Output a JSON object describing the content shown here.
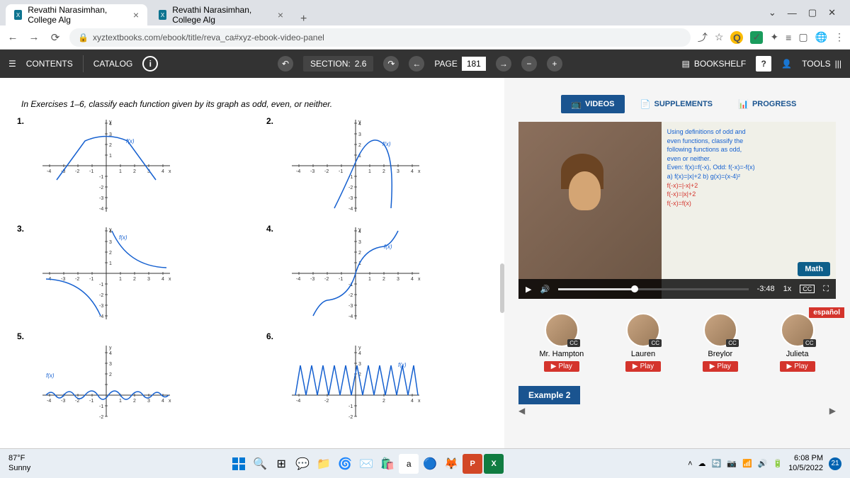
{
  "browser": {
    "tabs": [
      {
        "title": "Revathi Narasimhan, College Alg"
      },
      {
        "title": "Revathi Narasimhan, College Alg"
      }
    ],
    "url": "xyztextbooks.com/ebook/title/reva_ca#xyz-ebook-video-panel"
  },
  "toolbar": {
    "contents": "CONTENTS",
    "catalog": "CATALOG",
    "section_label": "SECTION:",
    "section_value": "2.6",
    "page_label": "PAGE",
    "page_value": "181",
    "bookshelf": "BOOKSHELF",
    "tools": "TOOLS"
  },
  "exercises": {
    "header": "In Exercises 1–6, classify each function given by its graph as odd, even, or neither.",
    "items": [
      "1.",
      "2.",
      "3.",
      "4.",
      "5.",
      "6."
    ],
    "fx_label": "f(x)",
    "y_label": "y",
    "x_label": "x"
  },
  "video_panel": {
    "tabs": {
      "videos": "VIDEOS",
      "supplements": "SUPPLEMENTS",
      "progress": "PROGRESS"
    },
    "whiteboard_lines": [
      "Using definitions of odd and",
      "even functions, classify the",
      "following functions as odd,",
      "even or neither.",
      "Even: f(x)=f(-x), Odd: f(-x)=-f(x)",
      "a) f(x)=|x|+2   b) g(x)=(x-4)²",
      "f(-x)=|-x|+2",
      "f(-x)=|x|+2",
      "f(-x)=f(x)"
    ],
    "logo": "Math",
    "time": "-3:48",
    "speed": "1x",
    "cc": "CC",
    "instructors": [
      {
        "name": "Mr. Hampton"
      },
      {
        "name": "Lauren"
      },
      {
        "name": "Breylor"
      },
      {
        "name": "Julieta"
      }
    ],
    "play_label": "Play",
    "cc_badge": "CC",
    "espanol": "español",
    "example": "Example 2"
  },
  "taskbar": {
    "temp": "87°F",
    "condition": "Sunny",
    "time": "6:08 PM",
    "date": "10/5/2022",
    "notifications": "21"
  },
  "chart_data": [
    {
      "id": 1,
      "type": "graph",
      "description": "Even tent/triangle function peaking at y≈3 at x=0, symmetric",
      "xrange": [
        -4,
        4
      ],
      "yrange": [
        -4,
        4
      ]
    },
    {
      "id": 2,
      "type": "graph",
      "description": "Cubic-like curve rising through origin then dipping",
      "xrange": [
        -4,
        4
      ],
      "yrange": [
        -4,
        4
      ]
    },
    {
      "id": 3,
      "type": "graph",
      "description": "Odd reciprocal-like curve with vertical asymptote at x=0",
      "xrange": [
        -4,
        4
      ],
      "yrange": [
        -4,
        4
      ]
    },
    {
      "id": 4,
      "type": "graph",
      "description": "S-curve / arctangent-like, odd symmetry",
      "xrange": [
        -4,
        4
      ],
      "yrange": [
        -4,
        4
      ]
    },
    {
      "id": 5,
      "type": "graph",
      "description": "Damped oscillation / sine wave variant",
      "xrange": [
        -4,
        4
      ],
      "yrange": [
        -2,
        4
      ]
    },
    {
      "id": 6,
      "type": "graph",
      "description": "High-frequency absolute sine wave, even",
      "xrange": [
        -4,
        4
      ],
      "yrange": [
        -2,
        4
      ]
    }
  ]
}
